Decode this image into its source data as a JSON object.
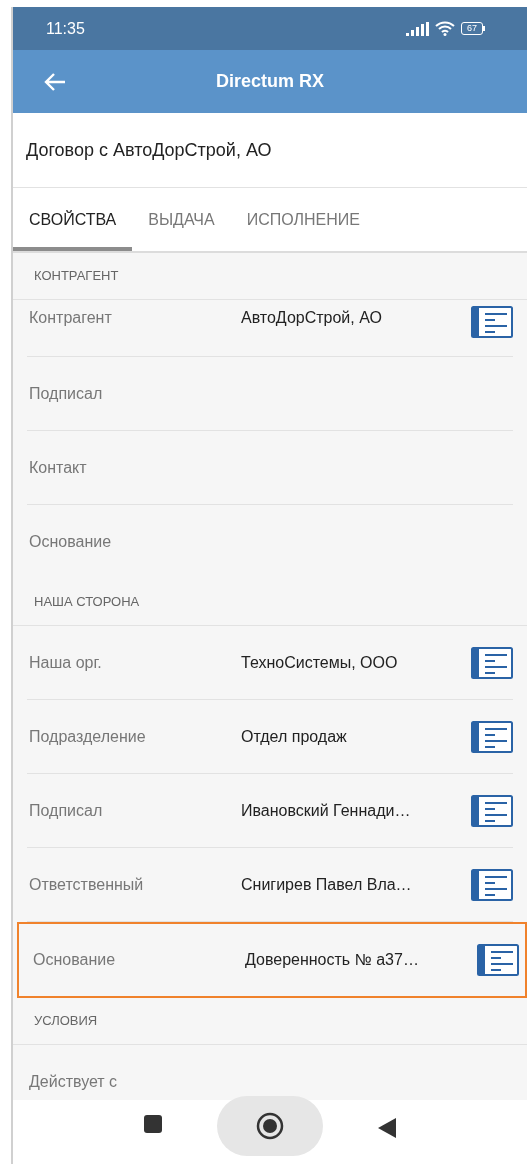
{
  "status_bar": {
    "time": "11:35",
    "battery": "67"
  },
  "app_bar": {
    "title": "Directum RX"
  },
  "document_title": "Договор с АвтоДорСтрой, АО",
  "tabs": [
    {
      "label": "СВОЙСТВА",
      "selected": true
    },
    {
      "label": "ВЫДАЧА",
      "selected": false
    },
    {
      "label": "ИСПОЛНЕНИЕ",
      "selected": false
    }
  ],
  "sections": [
    {
      "title": "КОНТРАГЕНТ",
      "rows": [
        {
          "label": "Контрагент",
          "value": "АвтоДорСтрой, АО",
          "selected": false
        },
        {
          "label": "Подписал",
          "selected": false
        },
        {
          "label": "Контакт",
          "selected": false
        },
        {
          "label": "Основание",
          "selected": false
        }
      ]
    },
    {
      "title": "НАША СТОРОНА",
      "rows": [
        {
          "label": "Наша орг.",
          "value": "ТехноСистемы, ООО",
          "selected": false
        },
        {
          "label": "Подразделение",
          "value": "Отдел продаж",
          "selected": false
        },
        {
          "label": "Подписал",
          "value": "Ивановский Геннади…",
          "selected": false
        },
        {
          "label": "Ответственный",
          "value": "Снигирев Павел Вла…",
          "selected": false
        },
        {
          "label": "Основание",
          "value": "Доверенность № а37…",
          "selected": true
        }
      ]
    },
    {
      "title": "УСЛОВИЯ",
      "rows": [
        {
          "label": "Действует с",
          "selected": false
        }
      ]
    }
  ]
}
